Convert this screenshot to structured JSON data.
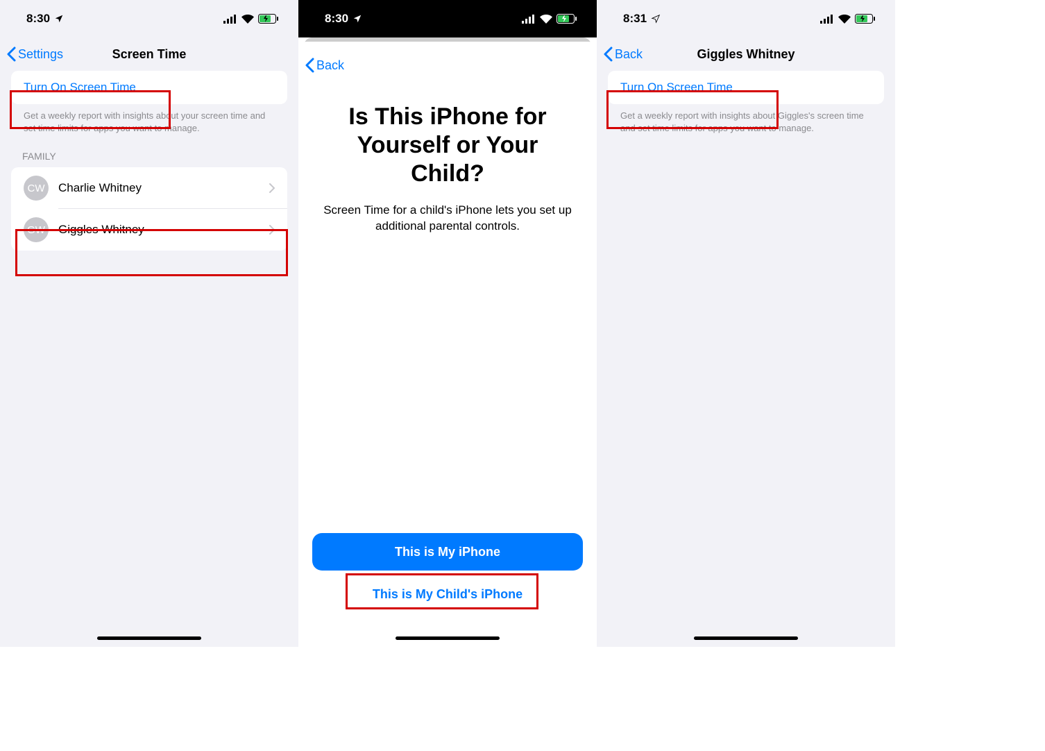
{
  "screen1": {
    "status": {
      "time": "8:30"
    },
    "nav": {
      "back": "Settings",
      "title": "Screen Time"
    },
    "turn_on": "Turn On Screen Time",
    "footer": "Get a weekly report with insights about your screen time and set time limits for apps you want to manage.",
    "family_header": "FAMILY",
    "family": [
      {
        "initials": "CW",
        "name": "Charlie Whitney"
      },
      {
        "initials": "GW",
        "name": "Giggles Whitney"
      }
    ]
  },
  "screen2": {
    "status": {
      "time": "8:30"
    },
    "nav": {
      "back": "Back"
    },
    "hero_title": "Is This iPhone for Yourself or Your Child?",
    "hero_sub": "Screen Time for a child's iPhone lets you set up additional parental controls.",
    "primary": "This is My iPhone",
    "secondary": "This is My Child's iPhone"
  },
  "screen3": {
    "status": {
      "time": "8:31"
    },
    "nav": {
      "back": "Back",
      "title": "Giggles Whitney"
    },
    "turn_on": "Turn On Screen Time",
    "footer": "Get a weekly report with insights about Giggles's screen time and set time limits for apps you want to manage."
  }
}
